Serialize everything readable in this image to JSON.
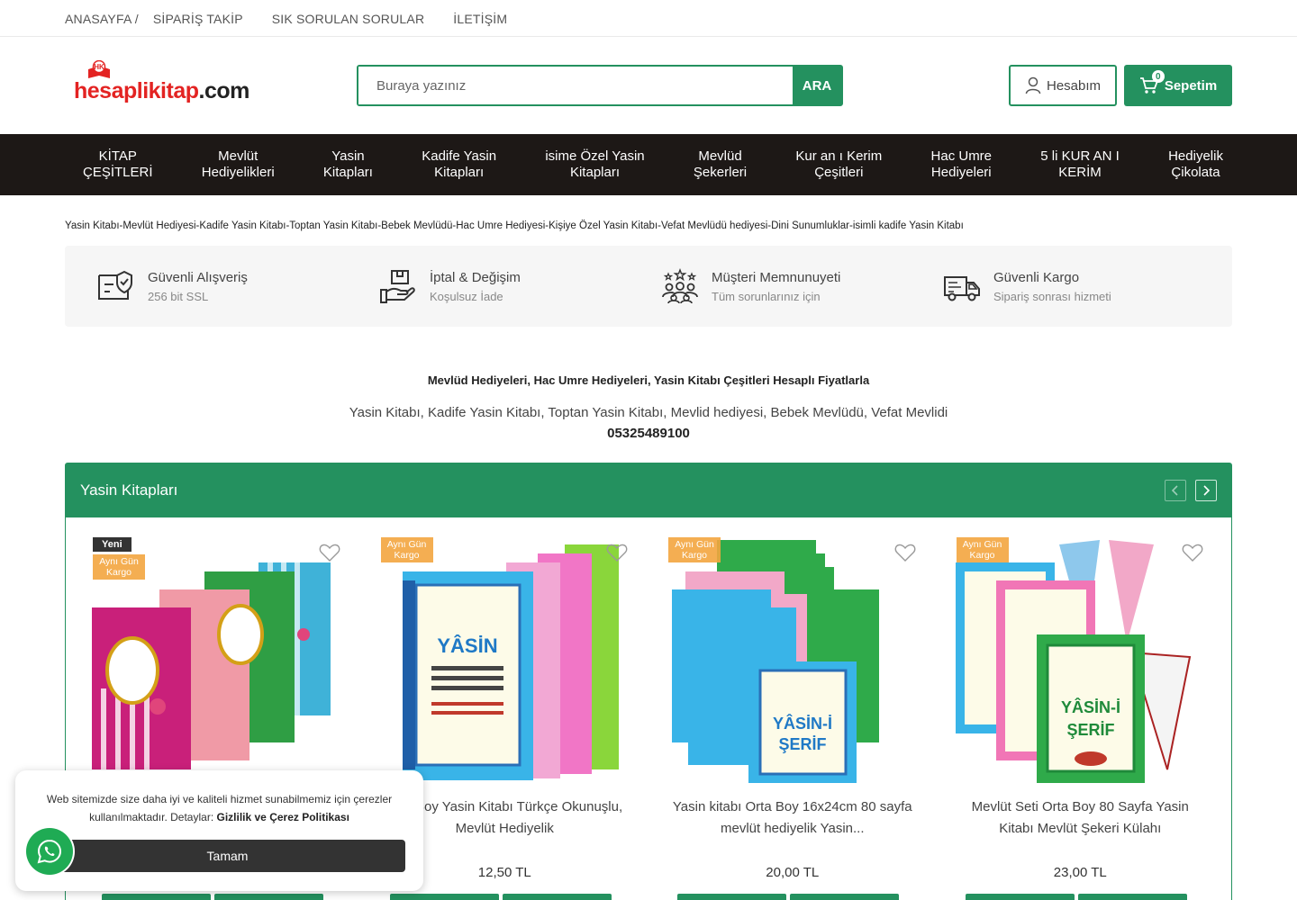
{
  "topbar": {
    "links": [
      "ANASAYFA /",
      "SİPARİŞ TAKİP",
      "SIK SORULAN SORULAR",
      "İLETİŞİM"
    ]
  },
  "header": {
    "logo_part1": "hesapli",
    "logo_part2": "kitap",
    "logo_part3": ".com",
    "search_placeholder": "Buraya yazınız",
    "search_button": "ARA",
    "account_label": "Hesabım",
    "cart_label": "Sepetim",
    "cart_count": "0"
  },
  "nav": {
    "items": [
      "KİTAP\nÇEŞİTLERİ",
      "Mevlüt\nHediyelikleri",
      "Yasin\nKitapları",
      "Kadife Yasin\nKitapları",
      "isime Özel Yasin\nKitapları",
      "Mevlüd\nŞekerleri",
      "Kur an ı Kerim\nÇeşitleri",
      "Hac Umre\nHediyeleri",
      "5 li KUR AN I\nKERİM",
      "Hediyelik\nÇikolata"
    ]
  },
  "tagline": "Yasin Kitabı-Mevlüt Hediyesi-Kadife Yasin Kitabı-Toptan Yasin Kitabı-Bebek Mevlüdü-Hac Umre Hediyesi-Kişiye Özel Yasin Kitabı-Vefat Mevlüdü hediyesi-Dini Sunumluklar-isimli kadife Yasin Kitabı",
  "features": [
    {
      "title": "Güvenli Alışveriş",
      "sub": "256 bit SSL",
      "icon": "secure-shopping-icon"
    },
    {
      "title": "İptal & Değişim",
      "sub": "Koşulsuz İade",
      "icon": "return-exchange-icon"
    },
    {
      "title": "Müşteri Memnunuyeti",
      "sub": "Tüm sorunlarınız için",
      "icon": "customer-satisfaction-icon"
    },
    {
      "title": "Güvenli Kargo",
      "sub": "Sipariş sonrası hizmeti",
      "icon": "delivery-truck-icon"
    }
  ],
  "intro": {
    "heading": "Mevlüd Hediyeleri, Hac Umre Hediyeleri, Yasin Kitabı Çeşitleri Hesaplı Fiyatlarla",
    "text": "Yasin Kitabı, Kadife Yasin Kitabı, Toptan Yasin Kitabı, Mevlid hediyesi, Bebek Mevlüdü, Vefat Mevlidi",
    "phone": "05325489100"
  },
  "section": {
    "title": "Yasin Kitapları",
    "prev_icon": "chevron-left-icon",
    "next_icon": "chevron-right-icon"
  },
  "products": [
    {
      "badge_new": "Yeni",
      "badge_kargo": "Aynı Gün Kargo",
      "name": "",
      "price": ""
    },
    {
      "badge_new": "",
      "badge_kargo": "Aynı Gün Kargo",
      "name": "Cep Boy Yasin Kitabı Türkçe Okunuşlu, Mevlüt Hediyelik",
      "price": "12,50 TL"
    },
    {
      "badge_new": "",
      "badge_kargo": "Aynı Gün Kargo",
      "name": "Yasin kitabı Orta Boy 16x24cm 80 sayfa mevlüt hediyelik Yasin...",
      "price": "20,00 TL"
    },
    {
      "badge_new": "",
      "badge_kargo": "Aynı Gün Kargo",
      "name": "Mevlüt Seti Orta Boy 80 Sayfa Yasin Kitabı Mevlüt Şekeri Külahı",
      "price": "23,00 TL"
    }
  ],
  "cookie": {
    "text": "Web sitemizde size daha iyi ve kaliteli hizmet sunabilmemiz için çerezler kullanılmaktadır. Detaylar:",
    "link": "Gizlilik ve Çerez Politikası",
    "button": "Tamam"
  },
  "colors": {
    "brand_green": "#24915f",
    "nav_bg": "#1d1816",
    "badge_orange": "#f3a640",
    "logo_red": "#e32322"
  }
}
